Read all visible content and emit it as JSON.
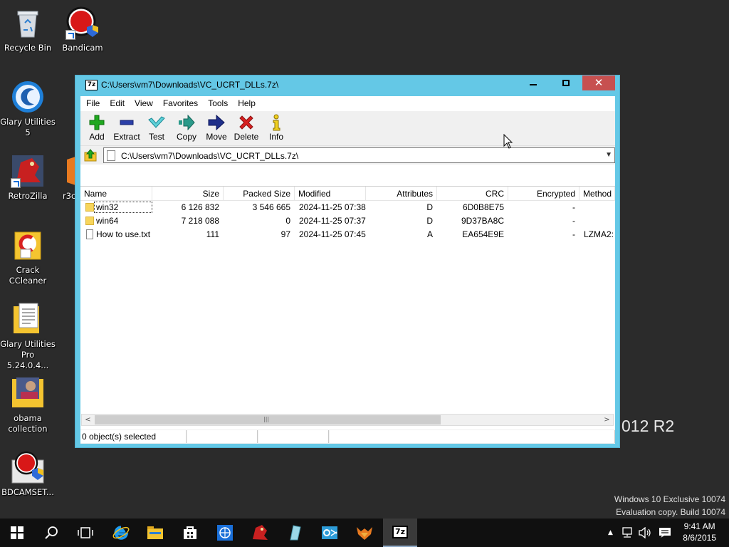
{
  "desktop": {
    "icons": [
      {
        "label": "Recycle Bin"
      },
      {
        "label": "Bandicam"
      },
      {
        "label": "Glary Utilities 5"
      },
      {
        "label": "RetroZilla"
      },
      {
        "label": "r3c"
      },
      {
        "label": "Crack CCleaner"
      },
      {
        "label": "Glary Utilities Pro 5.24.0.4..."
      },
      {
        "label": "obama collection"
      },
      {
        "label": "BDCAMSET..."
      }
    ],
    "watermark": "012 R2",
    "eval_line1": "Windows 10 Exclusive 10074",
    "eval_line2": "Evaluation copy. Build 10074"
  },
  "window": {
    "title": "C:\\Users\\vm7\\Downloads\\VC_UCRT_DLLs.7z\\",
    "app_icon_text": "7z",
    "menu": [
      "File",
      "Edit",
      "View",
      "Favorites",
      "Tools",
      "Help"
    ],
    "toolbar": [
      {
        "label": "Add",
        "icon": "plus-icon",
        "color": "#1fa81f"
      },
      {
        "label": "Extract",
        "icon": "minus-icon",
        "color": "#2b3fa8"
      },
      {
        "label": "Test",
        "icon": "check-icon",
        "color": "#2bb8c8"
      },
      {
        "label": "Copy",
        "icon": "copy-arrow-icon",
        "color": "#2a9a8a"
      },
      {
        "label": "Move",
        "icon": "move-arrow-icon",
        "color": "#1f2f8a"
      },
      {
        "label": "Delete",
        "icon": "x-icon",
        "color": "#d82020"
      },
      {
        "label": "Info",
        "icon": "info-icon",
        "color": "#c8a800"
      }
    ],
    "address": "C:\\Users\\vm7\\Downloads\\VC_UCRT_DLLs.7z\\",
    "columns": [
      "Name",
      "Size",
      "Packed Size",
      "Modified",
      "Attributes",
      "CRC",
      "Encrypted",
      "Method"
    ],
    "rows": [
      {
        "name": "win32",
        "size": "6 126 832",
        "packed": "3 546 665",
        "modified": "2024-11-25 07:38",
        "attr": "D",
        "crc": "6D0B8E75",
        "enc": "-",
        "method": "",
        "type": "folder"
      },
      {
        "name": "win64",
        "size": "7 218 088",
        "packed": "0",
        "modified": "2024-11-25 07:37",
        "attr": "D",
        "crc": "9D37BA8C",
        "enc": "-",
        "method": "",
        "type": "folder"
      },
      {
        "name": "How to use.txt",
        "size": "111",
        "packed": "97",
        "modified": "2024-11-25 07:45",
        "attr": "A",
        "crc": "EA654E9E",
        "enc": "-",
        "method": "LZMA2:",
        "type": "file"
      }
    ],
    "status": "0 object(s) selected"
  },
  "taskbar": {
    "time": "9:41 AM",
    "date": "8/6/2015"
  }
}
